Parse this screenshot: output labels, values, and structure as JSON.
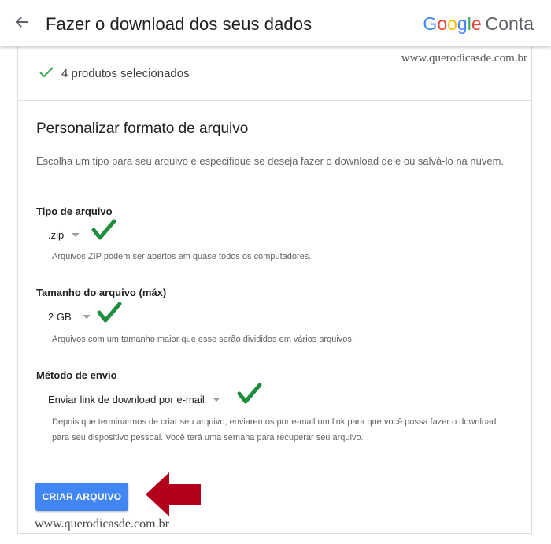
{
  "header": {
    "title": "Fazer o download dos seus dados",
    "brand_letters": [
      "G",
      "o",
      "o",
      "g",
      "l",
      "e"
    ],
    "brand_suffix": "Conta"
  },
  "watermark": {
    "top": "www.querodicasde.com.br",
    "bottom": "www.querodicasde.com.br"
  },
  "selected": {
    "text": "4 produtos selecionados"
  },
  "section": {
    "title": "Personalizar formato de arquivo",
    "description": "Escolha um tipo para seu arquivo e especifique se deseja fazer o download dele ou salvá-lo na nuvem."
  },
  "fields": {
    "file_type": {
      "label": "Tipo de arquivo",
      "value": ".zip",
      "help": "Arquivos ZIP podem ser abertos em quase todos os computadores."
    },
    "file_size": {
      "label": "Tamanho do arquivo (máx)",
      "value": "2 GB",
      "help": "Arquivos com um tamanho maior que esse serão divididos em vários arquivos."
    },
    "delivery": {
      "label": "Método de envio",
      "value": "Enviar link de download por e-mail",
      "help": "Depois que terminarmos de criar seu arquivo, enviaremos por e-mail um link para que você possa fazer o download para seu dispositivo pessoal. Você terá uma semana para recuperar seu arquivo."
    }
  },
  "actions": {
    "create_label": "CRIAR ARQUIVO"
  },
  "colors": {
    "accent": "#4285f4",
    "check_gray_green": "#34a853",
    "annotation_green": "#1e8e3e",
    "annotation_red": "#b3001b"
  },
  "icons": {
    "back": "arrow-left-icon",
    "selected": "checkmark-icon",
    "annotation_check": "green-check-annotation-icon",
    "annotation_arrow": "red-arrow-annotation-icon"
  }
}
